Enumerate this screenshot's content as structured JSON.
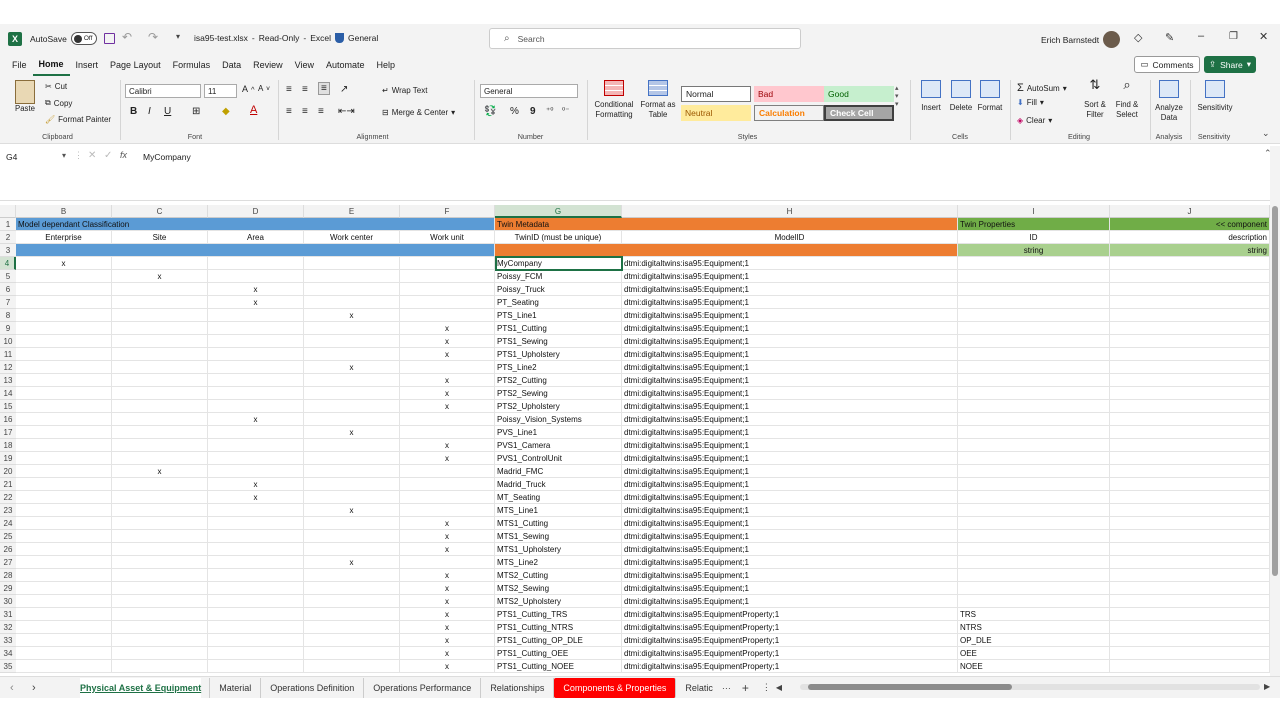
{
  "titlebar": {
    "autosave_label": "AutoSave",
    "autosave_state": "Off",
    "filename": "isa95-test.xlsx",
    "separator": "-",
    "readonly": "Read-Only",
    "app": "Excel",
    "sensitivity": "General",
    "search_placeholder": "Search",
    "user": "Erich Barnstedt"
  },
  "menu": [
    "File",
    "Home",
    "Insert",
    "Page Layout",
    "Formulas",
    "Data",
    "Review",
    "View",
    "Automate",
    "Help"
  ],
  "buttons": {
    "comments": "Comments",
    "share": "Share"
  },
  "ribbon": {
    "clipboard": {
      "paste": "Paste",
      "cut": "Cut",
      "copy": "Copy",
      "format_painter": "Format Painter",
      "label": "Clipboard"
    },
    "font": {
      "family": "Calibri",
      "size": "11",
      "label": "Font",
      "bold": "B",
      "italic": "I",
      "underline": "U"
    },
    "alignment": {
      "wrap": "Wrap Text",
      "merge": "Merge & Center",
      "label": "Alignment"
    },
    "number": {
      "format": "General",
      "percent": "%",
      "comma": "9",
      "label": "Number"
    },
    "styles": {
      "conditional": "Conditional Formatting",
      "format_table": "Format as Table",
      "normal": "Normal",
      "bad": "Bad",
      "good": "Good",
      "neutral": "Neutral",
      "calculation": "Calculation",
      "check": "Check Cell",
      "label": "Styles"
    },
    "cells": {
      "insert": "Insert",
      "delete": "Delete",
      "format": "Format",
      "label": "Cells"
    },
    "editing": {
      "autosum": "AutoSum",
      "fill": "Fill",
      "clear": "Clear",
      "sort": "Sort & Filter",
      "find": "Find & Select",
      "label": "Editing"
    },
    "analysis": {
      "analyze": "Analyze Data",
      "label": "Analysis"
    },
    "sensitivity": {
      "btn": "Sensitivity",
      "label": "Sensitivity"
    }
  },
  "formula": {
    "namebox": "G4",
    "fx": "fx",
    "value": "MyCompany"
  },
  "columns": [
    "B",
    "C",
    "D",
    "E",
    "F",
    "G",
    "H",
    "I",
    "J"
  ],
  "header_rows": {
    "row1": {
      "classification": "Model dependant Classification",
      "twin_metadata": "Twin Metadata",
      "twin_properties": "Twin Properties",
      "component": "<< component"
    },
    "row2": {
      "enterprise": "Enterprise",
      "site": "Site",
      "area": "Area",
      "workcenter": "Work center",
      "workunit": "Work unit",
      "twinid": "TwinID (must be unique)",
      "modelid": "ModelID",
      "id": "ID",
      "description": "description"
    },
    "row3": {
      "i_type": "string",
      "j_type": "string"
    }
  },
  "rows": [
    {
      "n": "4",
      "level": "B",
      "mark": "x",
      "twin": "MyCompany",
      "model": "dtmi:digitaltwins:isa95:Equipment;1",
      "id": ""
    },
    {
      "n": "5",
      "level": "C",
      "mark": "x",
      "twin": "Poissy_FCM",
      "model": "dtmi:digitaltwins:isa95:Equipment;1",
      "id": ""
    },
    {
      "n": "6",
      "level": "D",
      "mark": "x",
      "twin": "Poissy_Truck",
      "model": "dtmi:digitaltwins:isa95:Equipment;1",
      "id": ""
    },
    {
      "n": "7",
      "level": "D",
      "mark": "x",
      "twin": "PT_Seating",
      "model": "dtmi:digitaltwins:isa95:Equipment;1",
      "id": ""
    },
    {
      "n": "8",
      "level": "E",
      "mark": "x",
      "twin": "PTS_Line1",
      "model": "dtmi:digitaltwins:isa95:Equipment;1",
      "id": ""
    },
    {
      "n": "9",
      "level": "F",
      "mark": "x",
      "twin": "PTS1_Cutting",
      "model": "dtmi:digitaltwins:isa95:Equipment;1",
      "id": ""
    },
    {
      "n": "10",
      "level": "F",
      "mark": "x",
      "twin": "PTS1_Sewing",
      "model": "dtmi:digitaltwins:isa95:Equipment;1",
      "id": ""
    },
    {
      "n": "11",
      "level": "F",
      "mark": "x",
      "twin": "PTS1_Upholstery",
      "model": "dtmi:digitaltwins:isa95:Equipment;1",
      "id": ""
    },
    {
      "n": "12",
      "level": "E",
      "mark": "x",
      "twin": "PTS_Line2",
      "model": "dtmi:digitaltwins:isa95:Equipment;1",
      "id": ""
    },
    {
      "n": "13",
      "level": "F",
      "mark": "x",
      "twin": "PTS2_Cutting",
      "model": "dtmi:digitaltwins:isa95:Equipment;1",
      "id": ""
    },
    {
      "n": "14",
      "level": "F",
      "mark": "x",
      "twin": "PTS2_Sewing",
      "model": "dtmi:digitaltwins:isa95:Equipment;1",
      "id": ""
    },
    {
      "n": "15",
      "level": "F",
      "mark": "x",
      "twin": "PTS2_Upholstery",
      "model": "dtmi:digitaltwins:isa95:Equipment;1",
      "id": ""
    },
    {
      "n": "16",
      "level": "D",
      "mark": "x",
      "twin": "Poissy_Vision_Systems",
      "model": "dtmi:digitaltwins:isa95:Equipment;1",
      "id": ""
    },
    {
      "n": "17",
      "level": "E",
      "mark": "x",
      "twin": "PVS_Line1",
      "model": "dtmi:digitaltwins:isa95:Equipment;1",
      "id": ""
    },
    {
      "n": "18",
      "level": "F",
      "mark": "x",
      "twin": "PVS1_Camera",
      "model": "dtmi:digitaltwins:isa95:Equipment;1",
      "id": ""
    },
    {
      "n": "19",
      "level": "F",
      "mark": "x",
      "twin": "PVS1_ControlUnit",
      "model": "dtmi:digitaltwins:isa95:Equipment;1",
      "id": ""
    },
    {
      "n": "20",
      "level": "C",
      "mark": "x",
      "twin": "Madrid_FMC",
      "model": "dtmi:digitaltwins:isa95:Equipment;1",
      "id": ""
    },
    {
      "n": "21",
      "level": "D",
      "mark": "x",
      "twin": "Madrid_Truck",
      "model": "dtmi:digitaltwins:isa95:Equipment;1",
      "id": ""
    },
    {
      "n": "22",
      "level": "D",
      "mark": "x",
      "twin": "MT_Seating",
      "model": "dtmi:digitaltwins:isa95:Equipment;1",
      "id": ""
    },
    {
      "n": "23",
      "level": "E",
      "mark": "x",
      "twin": "MTS_Line1",
      "model": "dtmi:digitaltwins:isa95:Equipment;1",
      "id": ""
    },
    {
      "n": "24",
      "level": "F",
      "mark": "x",
      "twin": "MTS1_Cutting",
      "model": "dtmi:digitaltwins:isa95:Equipment;1",
      "id": ""
    },
    {
      "n": "25",
      "level": "F",
      "mark": "x",
      "twin": "MTS1_Sewing",
      "model": "dtmi:digitaltwins:isa95:Equipment;1",
      "id": ""
    },
    {
      "n": "26",
      "level": "F",
      "mark": "x",
      "twin": "MTS1_Upholstery",
      "model": "dtmi:digitaltwins:isa95:Equipment;1",
      "id": ""
    },
    {
      "n": "27",
      "level": "E",
      "mark": "x",
      "twin": "MTS_Line2",
      "model": "dtmi:digitaltwins:isa95:Equipment;1",
      "id": ""
    },
    {
      "n": "28",
      "level": "F",
      "mark": "x",
      "twin": "MTS2_Cutting",
      "model": "dtmi:digitaltwins:isa95:Equipment;1",
      "id": ""
    },
    {
      "n": "29",
      "level": "F",
      "mark": "x",
      "twin": "MTS2_Sewing",
      "model": "dtmi:digitaltwins:isa95:Equipment;1",
      "id": ""
    },
    {
      "n": "30",
      "level": "F",
      "mark": "x",
      "twin": "MTS2_Upholstery",
      "model": "dtmi:digitaltwins:isa95:Equipment;1",
      "id": ""
    },
    {
      "n": "31",
      "level": "F",
      "mark": "x",
      "twin": "PTS1_Cutting_TRS",
      "model": "dtmi:digitaltwins:isa95:EquipmentProperty;1",
      "id": "TRS"
    },
    {
      "n": "32",
      "level": "F",
      "mark": "x",
      "twin": "PTS1_Cutting_NTRS",
      "model": "dtmi:digitaltwins:isa95:EquipmentProperty;1",
      "id": "NTRS"
    },
    {
      "n": "33",
      "level": "F",
      "mark": "x",
      "twin": "PTS1_Cutting_OP_DLE",
      "model": "dtmi:digitaltwins:isa95:EquipmentProperty;1",
      "id": "OP_DLE"
    },
    {
      "n": "34",
      "level": "F",
      "mark": "x",
      "twin": "PTS1_Cutting_OEE",
      "model": "dtmi:digitaltwins:isa95:EquipmentProperty;1",
      "id": "OEE"
    },
    {
      "n": "35",
      "level": "F",
      "mark": "x",
      "twin": "PTS1_Cutting_NOEE",
      "model": "dtmi:digitaltwins:isa95:EquipmentProperty;1",
      "id": "NOEE"
    }
  ],
  "sheets": [
    "Physical Asset & Equipment",
    "Material",
    "Operations Definition",
    "Operations Performance",
    "Relationships",
    "Components & Properties",
    "Relatic"
  ],
  "colors": {
    "blue": "#5b9bd5",
    "orange": "#ed7d31",
    "green": "#70ad47",
    "light_green": "#a9d08e",
    "excel_green": "#1e7145",
    "red_tab": "#ff0000"
  }
}
